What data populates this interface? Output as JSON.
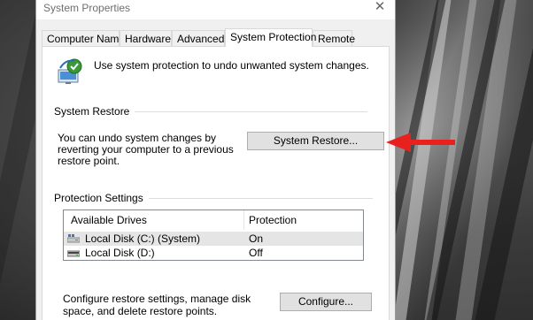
{
  "window": {
    "title": "System Properties",
    "close_glyph": "✕"
  },
  "tabs": [
    {
      "label": "Computer Name"
    },
    {
      "label": "Hardware"
    },
    {
      "label": "Advanced"
    },
    {
      "label": "System Protection",
      "active": true
    },
    {
      "label": "Remote"
    }
  ],
  "intro": {
    "icon": "system-protection-icon",
    "text": "Use system protection to undo unwanted system changes."
  },
  "system_restore": {
    "group_title": "System Restore",
    "description": "You can undo system changes by reverting your computer to a previous restore point.",
    "button_label": "System Restore..."
  },
  "protection_settings": {
    "group_title": "Protection Settings",
    "columns": [
      "Available Drives",
      "Protection"
    ],
    "drives": [
      {
        "name": "Local Disk (C:) (System)",
        "protection": "On",
        "icon": "system-drive-icon",
        "selected": true
      },
      {
        "name": "Local Disk (D:)",
        "protection": "Off",
        "icon": "drive-icon",
        "selected": false
      }
    ]
  },
  "configure": {
    "description": "Configure restore settings, manage disk space, and delete restore points.",
    "button_label": "Configure..."
  },
  "annotation": {
    "arrow_color": "#e8201e",
    "icon": "red-arrow-icon"
  }
}
